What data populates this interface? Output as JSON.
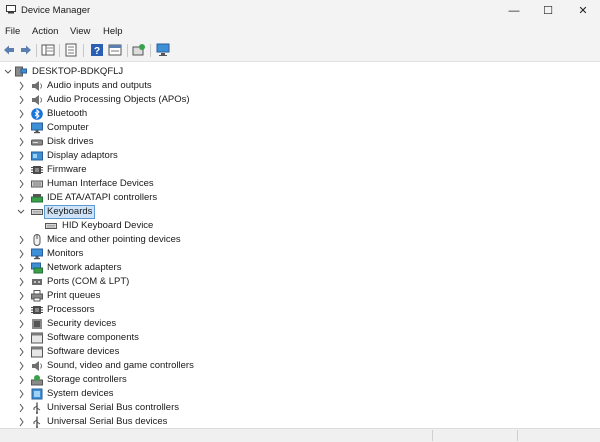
{
  "window": {
    "title": "Device Manager",
    "minimize": "—",
    "maximize": "☐",
    "close": "✕"
  },
  "menu": [
    "File",
    "Action",
    "View",
    "Help"
  ],
  "toolbar": [
    "back-icon",
    "forward-icon",
    "show-hide-tree-icon",
    "properties-icon",
    "help-icon",
    "view-icon",
    "update-driver-icon",
    "monitor-scan-icon"
  ],
  "tree": {
    "root": "DESKTOP-BDKQFLJ",
    "categories": [
      {
        "label": "Audio inputs and outputs",
        "icon": "speaker-icon"
      },
      {
        "label": "Audio Processing Objects (APOs)",
        "icon": "speaker-icon"
      },
      {
        "label": "Bluetooth",
        "icon": "bluetooth-icon"
      },
      {
        "label": "Computer",
        "icon": "monitor-icon"
      },
      {
        "label": "Disk drives",
        "icon": "disk-drive-icon"
      },
      {
        "label": "Display adaptors",
        "icon": "display-adapter-icon"
      },
      {
        "label": "Firmware",
        "icon": "chip-icon"
      },
      {
        "label": "Human Interface Devices",
        "icon": "hid-icon"
      },
      {
        "label": "IDE ATA/ATAPI controllers",
        "icon": "controller-icon"
      },
      {
        "label": "Keyboards",
        "icon": "keyboard-icon",
        "expanded": true,
        "selected": true,
        "children": [
          {
            "label": "HID Keyboard Device",
            "icon": "keyboard-icon"
          }
        ]
      },
      {
        "label": "Mice and other pointing devices",
        "icon": "mouse-icon"
      },
      {
        "label": "Monitors",
        "icon": "monitor-icon"
      },
      {
        "label": "Network adapters",
        "icon": "network-icon"
      },
      {
        "label": "Ports (COM & LPT)",
        "icon": "port-icon"
      },
      {
        "label": "Print queues",
        "icon": "printer-icon"
      },
      {
        "label": "Processors",
        "icon": "chip-icon"
      },
      {
        "label": "Security devices",
        "icon": "security-icon"
      },
      {
        "label": "Software components",
        "icon": "software-icon"
      },
      {
        "label": "Software devices",
        "icon": "software-icon"
      },
      {
        "label": "Sound, video and game controllers",
        "icon": "speaker-icon"
      },
      {
        "label": "Storage controllers",
        "icon": "storage-icon"
      },
      {
        "label": "System devices",
        "icon": "system-icon"
      },
      {
        "label": "Universal Serial Bus controllers",
        "icon": "usb-icon"
      },
      {
        "label": "Universal Serial Bus devices",
        "icon": "usb-icon"
      }
    ]
  }
}
